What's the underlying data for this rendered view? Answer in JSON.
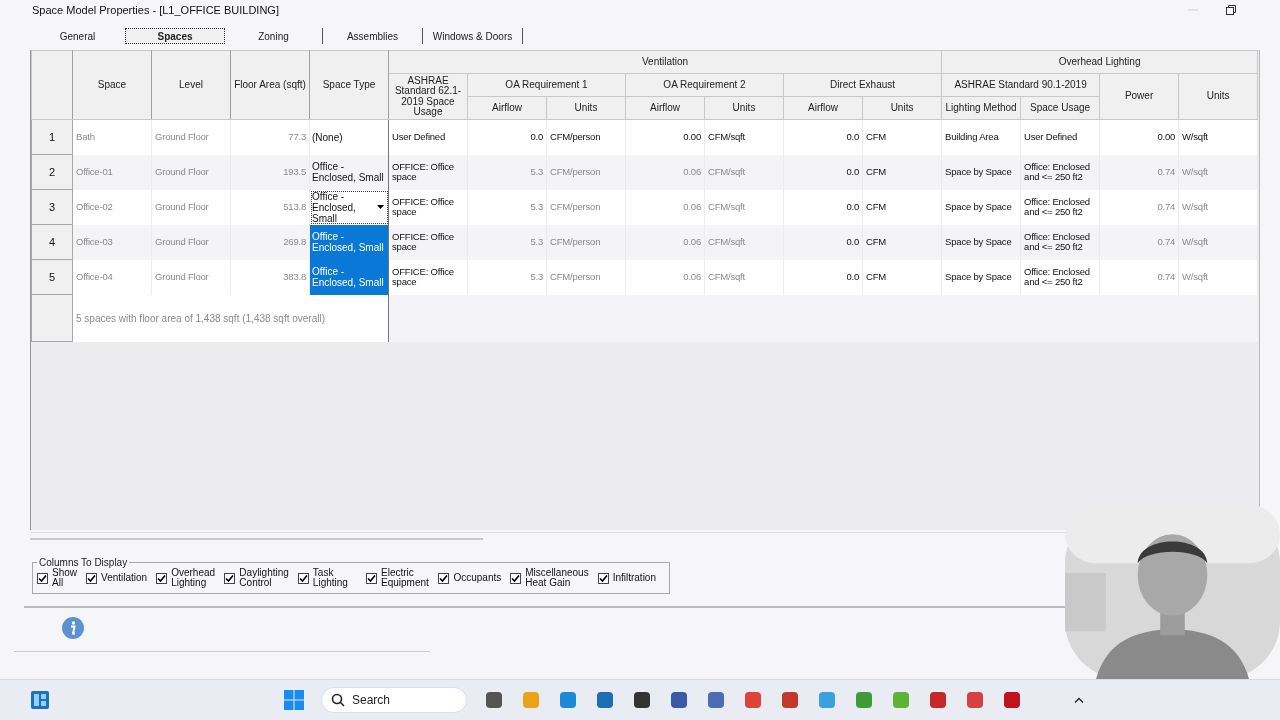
{
  "window": {
    "title": "Space Model Properties - [L1_OFFICE BUILDING]"
  },
  "tabs": [
    {
      "label": "General",
      "selected": false
    },
    {
      "label": "Spaces",
      "selected": true
    },
    {
      "label": "Zoning",
      "selected": false
    },
    {
      "label": "Assemblies",
      "selected": false
    },
    {
      "label": "Windows & Doors",
      "selected": false
    }
  ],
  "table": {
    "fixed_columns": [
      "Space",
      "Level",
      "Floor Area (sqft)",
      "Space Type"
    ],
    "groups": [
      {
        "label": "Ventilation",
        "subgroups": [
          {
            "label": "ASHRAE Standard 62.1-2019  Space Usage"
          },
          {
            "label": "OA Requirement 1",
            "columns": [
              "Airflow",
              "Units"
            ]
          },
          {
            "label": "OA Requirement 2",
            "columns": [
              "Airflow",
              "Units"
            ]
          },
          {
            "label": "Direct Exhaust",
            "columns": [
              "Airflow",
              "Units"
            ]
          }
        ]
      },
      {
        "label": "Overhead Lighting",
        "subgroups": [
          {
            "label": "ASHRAE Standard 90.1-2019",
            "columns": [
              "Lighting Method",
              "Space Usage"
            ]
          },
          {
            "label": "Power"
          },
          {
            "label": "Units"
          }
        ]
      }
    ],
    "rows": [
      {
        "number": "1",
        "space_type_selected": false,
        "space_type_editing": false,
        "cells": [
          {
            "text": "Bath",
            "dimmed": true
          },
          {
            "text": "Ground Floor",
            "dimmed": true
          },
          {
            "text": "77.3",
            "dimmed": true
          },
          {
            "text": "(None)",
            "dimmed": false
          },
          {
            "text": "User Defined",
            "dimmed": false
          },
          {
            "text": "0.0",
            "dimmed": false
          },
          {
            "text": "CFM/person",
            "dimmed": false
          },
          {
            "text": "0.00",
            "dimmed": false
          },
          {
            "text": "CFM/sqft",
            "dimmed": false
          },
          {
            "text": "0.0",
            "dimmed": false
          },
          {
            "text": "CFM",
            "dimmed": false
          },
          {
            "text": "Building Area",
            "dimmed": false
          },
          {
            "text": "User Defined",
            "dimmed": false
          },
          {
            "text": "0.00",
            "dimmed": false
          },
          {
            "text": "W/sqft",
            "dimmed": false
          }
        ]
      },
      {
        "number": "2",
        "space_type_selected": false,
        "space_type_editing": false,
        "cells": [
          {
            "text": "Office-01",
            "dimmed": true
          },
          {
            "text": "Ground Floor",
            "dimmed": true
          },
          {
            "text": "193.5",
            "dimmed": true
          },
          {
            "text": "Office - Enclosed, Small",
            "dimmed": false
          },
          {
            "text": "OFFICE: Office space",
            "dimmed": false
          },
          {
            "text": "5.3",
            "dimmed": true
          },
          {
            "text": "CFM/person",
            "dimmed": true
          },
          {
            "text": "0.06",
            "dimmed": true
          },
          {
            "text": "CFM/sqft",
            "dimmed": true
          },
          {
            "text": "0.0",
            "dimmed": false
          },
          {
            "text": "CFM",
            "dimmed": false
          },
          {
            "text": "Space by Space",
            "dimmed": false
          },
          {
            "text": "Office: Enclosed and <= 250 ft2",
            "dimmed": false
          },
          {
            "text": "0.74",
            "dimmed": true
          },
          {
            "text": "W/sqft",
            "dimmed": true
          }
        ]
      },
      {
        "number": "3",
        "space_type_selected": false,
        "space_type_editing": true,
        "cells": [
          {
            "text": "Office-02",
            "dimmed": true
          },
          {
            "text": "Ground Floor",
            "dimmed": true
          },
          {
            "text": "513.8",
            "dimmed": true
          },
          {
            "text": "Office - Enclosed, Small",
            "dimmed": false
          },
          {
            "text": "OFFICE: Office space",
            "dimmed": false
          },
          {
            "text": "5.3",
            "dimmed": true
          },
          {
            "text": "CFM/person",
            "dimmed": true
          },
          {
            "text": "0.06",
            "dimmed": true
          },
          {
            "text": "CFM/sqft",
            "dimmed": true
          },
          {
            "text": "0.0",
            "dimmed": false
          },
          {
            "text": "CFM",
            "dimmed": false
          },
          {
            "text": "Space by Space",
            "dimmed": false
          },
          {
            "text": "Office: Enclosed and <= 250 ft2",
            "dimmed": false
          },
          {
            "text": "0.74",
            "dimmed": true
          },
          {
            "text": "W/sqft",
            "dimmed": true
          }
        ]
      },
      {
        "number": "4",
        "space_type_selected": true,
        "space_type_editing": false,
        "cells": [
          {
            "text": "Office-03",
            "dimmed": true
          },
          {
            "text": "Ground Floor",
            "dimmed": true
          },
          {
            "text": "269.8",
            "dimmed": true
          },
          {
            "text": "Office - Enclosed, Small",
            "dimmed": false
          },
          {
            "text": "OFFICE: Office space",
            "dimmed": false
          },
          {
            "text": "5.3",
            "dimmed": true
          },
          {
            "text": "CFM/person",
            "dimmed": true
          },
          {
            "text": "0.06",
            "dimmed": true
          },
          {
            "text": "CFM/sqft",
            "dimmed": true
          },
          {
            "text": "0.0",
            "dimmed": false
          },
          {
            "text": "CFM",
            "dimmed": false
          },
          {
            "text": "Space by Space",
            "dimmed": false
          },
          {
            "text": "Office: Enclosed and <= 250 ft2",
            "dimmed": false
          },
          {
            "text": "0.74",
            "dimmed": true
          },
          {
            "text": "W/sqft",
            "dimmed": true
          }
        ]
      },
      {
        "number": "5",
        "space_type_selected": true,
        "space_type_editing": false,
        "cells": [
          {
            "text": "Office-04",
            "dimmed": true
          },
          {
            "text": "Ground Floor",
            "dimmed": true
          },
          {
            "text": "383.8",
            "dimmed": true
          },
          {
            "text": "Office - Enclosed, Small",
            "dimmed": false
          },
          {
            "text": "OFFICE: Office space",
            "dimmed": false
          },
          {
            "text": "5.3",
            "dimmed": true
          },
          {
            "text": "CFM/person",
            "dimmed": true
          },
          {
            "text": "0.06",
            "dimmed": true
          },
          {
            "text": "CFM/sqft",
            "dimmed": true
          },
          {
            "text": "0.0",
            "dimmed": false
          },
          {
            "text": "CFM",
            "dimmed": false
          },
          {
            "text": "Space by Space",
            "dimmed": false
          },
          {
            "text": "Office: Enclosed and <= 250 ft2",
            "dimmed": false
          },
          {
            "text": "0.74",
            "dimmed": true
          },
          {
            "text": "W/sqft",
            "dimmed": true
          }
        ]
      }
    ],
    "summary": "5 spaces with floor area of 1,438 sqft (1,438 sqft overall)"
  },
  "columns_to_display": {
    "title": "Columns To Display",
    "options": [
      {
        "label": "Show All",
        "checked": true
      },
      {
        "label": "Ventilation",
        "checked": true
      },
      {
        "label": "Overhead Lighting",
        "checked": true
      },
      {
        "label": "Daylighting Control",
        "checked": true
      },
      {
        "label": "Task Lighting",
        "checked": true
      },
      {
        "label": "Electric Equipment",
        "checked": true
      },
      {
        "label": "Occupants",
        "checked": true
      },
      {
        "label": "Miscellaneous Heat Gain",
        "checked": true
      },
      {
        "label": "Infiltration",
        "checked": true
      }
    ]
  },
  "taskbar": {
    "search": {
      "placeholder": "Search"
    }
  }
}
